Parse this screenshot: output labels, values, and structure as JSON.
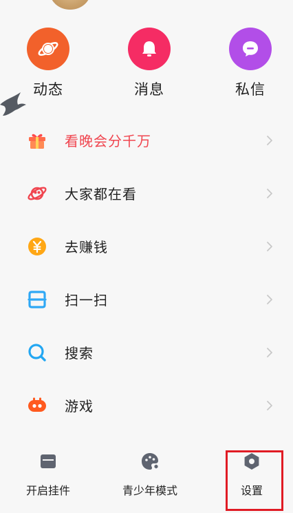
{
  "quick_actions": [
    {
      "label": "动态",
      "icon": "planet-icon",
      "color": "#f2612b"
    },
    {
      "label": "消息",
      "icon": "bell-icon",
      "color": "#f52c64"
    },
    {
      "label": "私信",
      "icon": "chat-bubble-icon",
      "color": "#b24ee8"
    }
  ],
  "menu": [
    {
      "label": "看晚会分千万",
      "icon": "gift-icon",
      "highlight": true
    },
    {
      "label": "大家都在看",
      "icon": "eye-planet-icon"
    },
    {
      "label": "去赚钱",
      "icon": "coin-icon"
    },
    {
      "label": "扫一扫",
      "icon": "scan-icon"
    },
    {
      "label": "搜索",
      "icon": "search-icon"
    },
    {
      "label": "游戏",
      "icon": "gamepad-icon"
    }
  ],
  "bottom": [
    {
      "label": "开启挂件",
      "icon": "widget-icon"
    },
    {
      "label": "青少年模式",
      "icon": "teen-mode-icon"
    },
    {
      "label": "设置",
      "icon": "settings-hexagon-icon"
    }
  ],
  "colors": {
    "accent_red": "#f0454f",
    "highlight_border": "#e01b24"
  }
}
